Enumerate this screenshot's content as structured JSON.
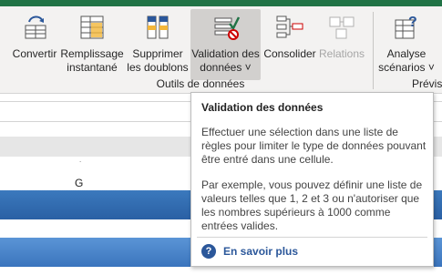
{
  "ribbon": {
    "buttons": [
      {
        "label": "Convertir",
        "icon": "text-to-columns-icon"
      },
      {
        "label": "Remplissage\ninstantané",
        "icon": "flash-fill-icon"
      },
      {
        "label": "Supprimer\nles doublons",
        "icon": "remove-duplicates-icon"
      },
      {
        "label": "Validation des\ndonnées ˅",
        "icon": "data-validation-icon"
      },
      {
        "label": "Consolider",
        "icon": "consolidate-icon"
      },
      {
        "label": "Relations",
        "icon": "relationships-icon"
      },
      {
        "label": "Analyse\nscénarios ˅",
        "icon": "what-if-analysis-icon"
      }
    ],
    "group_label": "Outils de données",
    "group_label2": "Prévisi"
  },
  "sheet": {
    "column_label": "G",
    "dot": "."
  },
  "tooltip": {
    "title": "Validation des données",
    "para1": "Effectuer une sélection dans une liste de règles pour limiter le type de données pouvant être entré dans une cellule.",
    "para2": "Par exemple, vous pouvez définir une liste de valeurs telles que 1, 2 et 3 ou n'autoriser que les nombres supérieurs à 1000 comme entrées valides.",
    "help_text": "En savoir plus",
    "help_icon": "?"
  },
  "colors": {
    "accent": "#217346",
    "link": "#2b579a",
    "table_band_dark": "#2a60a4",
    "table_band_light": "#3a74bd"
  }
}
